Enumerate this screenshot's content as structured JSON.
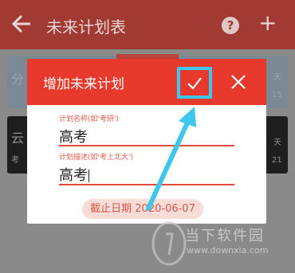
{
  "appbar": {
    "title": "未来计划表",
    "help_symbol": "?",
    "add_symbol": "+"
  },
  "background": {
    "card1_left": "分",
    "card1_right": "天",
    "card1_num": "15",
    "card2_left": "云",
    "card2_left2": "考",
    "card2_right": "天",
    "card2_num": "21"
  },
  "dialog": {
    "title": "增加未来计划",
    "name_label": "计划名称(如'考研')",
    "name_value": "高考",
    "desc_label": "计划描述(如'考上北大')",
    "desc_value": "高考",
    "deadline": "截止日期 2020-06-07"
  },
  "watermark": {
    "text": "当下软件园",
    "url": "www.downxia.com"
  },
  "colors": {
    "header": "#e83a2c",
    "highlight": "#3ec7ee",
    "appbar": "#a03a33"
  }
}
